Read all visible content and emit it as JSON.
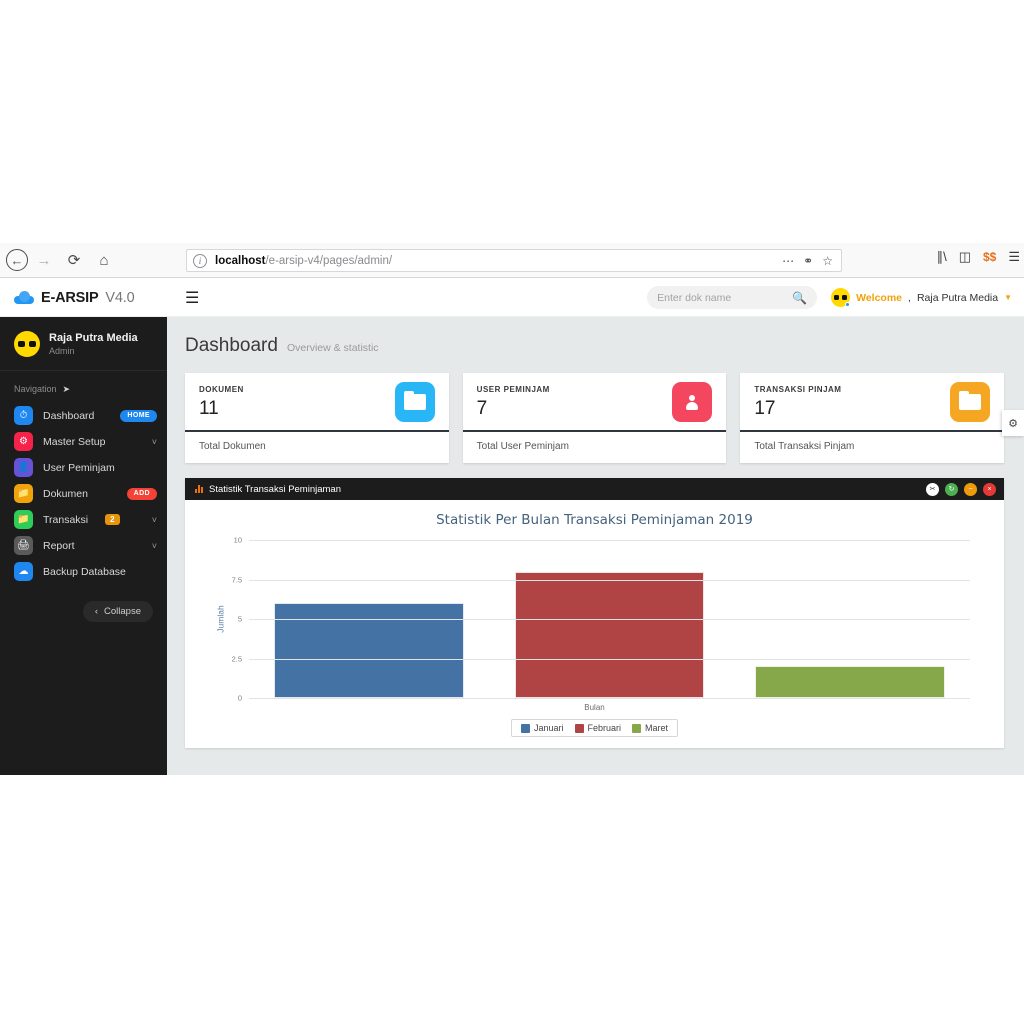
{
  "browser": {
    "back_icon": "arrow-left-icon",
    "forward_icon": "arrow-right-icon",
    "reload_icon": "reload-icon",
    "home_icon": "home-icon",
    "url_protocol_icon": "info-icon",
    "url_host": "localhost",
    "url_path": "/e-arsip-v4/pages/admin/",
    "page_actions_icon": "ellipsis-icon",
    "pocket_icon": "pocket-shield-icon",
    "bookmark_icon": "star-icon",
    "library_icon": "library-icon",
    "sidebar_icon": "sidebar-icon",
    "extension_icon": "extension-icon",
    "menu_icon": "hamburger-menu-icon"
  },
  "header": {
    "logo_icon": "cloud-logo-icon",
    "brand_name": "E-ARSIP",
    "brand_version": "V4.0",
    "toggle_icon": "hamburger-icon",
    "search_placeholder": "Enter dok name",
    "search_value": "",
    "search_icon": "search-icon",
    "avatar_icon": "user-avatar-icon",
    "welcome_label": "Welcome",
    "welcome_separator": ",",
    "user_name": "Raja Putra Media",
    "caret_icon": "chevron-down-icon"
  },
  "sidebar": {
    "user_name": "Raja Putra Media",
    "user_role": "Admin",
    "avatar_icon": "user-avatar-icon",
    "nav_heading": "Navigation",
    "nav_heading_icon": "paper-plane-icon",
    "items": [
      {
        "label": "Dashboard",
        "icon": "pulse-icon",
        "icon_color": "#1e88f0",
        "badge": "HOME",
        "badge_type": "home",
        "chevron": false
      },
      {
        "label": "Master Setup",
        "icon": "gear-icon",
        "icon_color": "#f5234a",
        "badge": "",
        "badge_type": "",
        "chevron": true
      },
      {
        "label": "User Peminjam",
        "icon": "user-icon",
        "icon_color": "#6554d8",
        "badge": "",
        "badge_type": "",
        "chevron": false
      },
      {
        "label": "Dokumen",
        "icon": "folder-icon",
        "icon_color": "#f0a30a",
        "badge": "ADD",
        "badge_type": "add",
        "chevron": false
      },
      {
        "label": "Transaksi",
        "icon": "folder-icon",
        "icon_color": "#2ecc59",
        "badge": "2",
        "badge_type": "num",
        "chevron": true
      },
      {
        "label": "Report",
        "icon": "printer-icon",
        "icon_color": "#5a5a5a",
        "badge": "",
        "badge_type": "",
        "chevron": true
      },
      {
        "label": "Backup Database",
        "icon": "cloud-icon",
        "icon_color": "#1e88f0",
        "badge": "",
        "badge_type": "",
        "chevron": false
      }
    ],
    "collapse_label": "Collapse",
    "collapse_icon": "chevron-left-icon"
  },
  "main": {
    "title": "Dashboard",
    "subtitle": "Overview & statistic",
    "cards": [
      {
        "label": "DOKUMEN",
        "value": "11",
        "footer": "Total Dokumen",
        "icon": "folder-icon",
        "icon_color": "#29b6f6"
      },
      {
        "label": "USER PEMINJAM",
        "value": "7",
        "footer": "Total User Peminjam",
        "icon": "person-icon",
        "icon_color": "#f4475f"
      },
      {
        "label": "TRANSAKSI PINJAM",
        "value": "17",
        "footer": "Total Transaksi Pinjam",
        "icon": "folder-icon",
        "icon_color": "#f5a623"
      }
    ],
    "panel": {
      "title": "Statistik Transaksi Peminjaman",
      "title_icon": "bar-chart-icon",
      "buttons": [
        {
          "name": "wrench-button",
          "icon": "wrench-icon",
          "color": "#ffffff"
        },
        {
          "name": "refresh-button",
          "icon": "refresh-icon",
          "color": "#4caf50"
        },
        {
          "name": "minimize-button",
          "icon": "minus-icon",
          "color": "#ef9a0d"
        },
        {
          "name": "close-button",
          "icon": "close-icon",
          "color": "#e53935"
        }
      ]
    },
    "settings_tab_icon": "gear-icon"
  },
  "chart_data": {
    "type": "bar",
    "title": "Statistik Per Bulan Transaksi Peminjaman 2019",
    "xlabel": "Bulan",
    "ylabel": "Jumlah",
    "categories": [
      "Januari",
      "Februari",
      "Maret"
    ],
    "values": [
      6,
      8,
      2
    ],
    "colors": [
      "#4472a5",
      "#b04343",
      "#86a84a"
    ],
    "ylim": [
      0,
      10
    ],
    "yticks": [
      0,
      2.5,
      5,
      7.5,
      10
    ],
    "ytick_labels": [
      "0",
      "2.5",
      "5",
      "7.5",
      "10"
    ],
    "grid": true,
    "legend_position": "bottom",
    "legend": [
      {
        "label": "Januari",
        "color": "#4472a5"
      },
      {
        "label": "Februari",
        "color": "#b04343"
      },
      {
        "label": "Maret",
        "color": "#86a84a"
      }
    ]
  }
}
